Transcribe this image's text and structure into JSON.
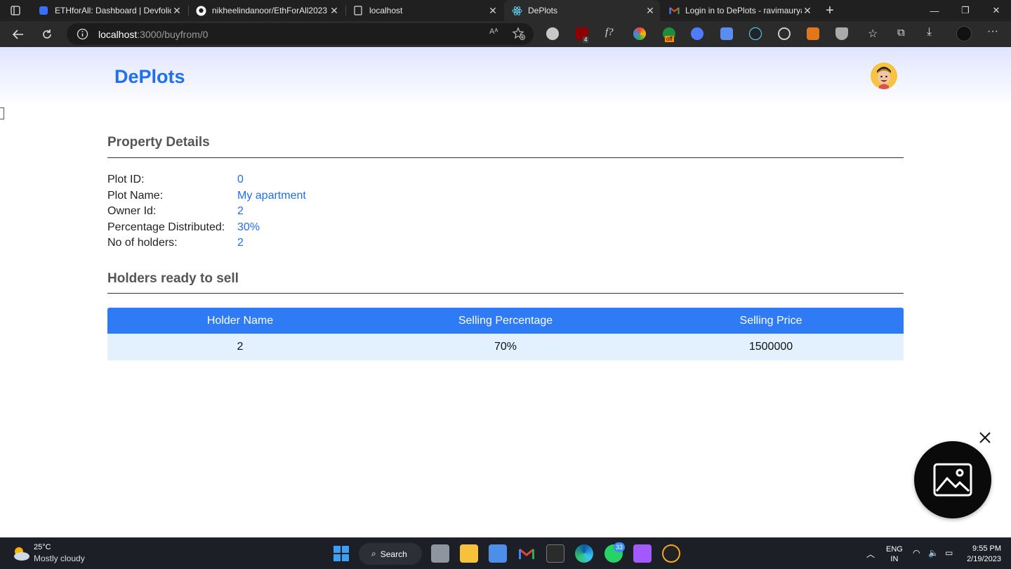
{
  "browser": {
    "tabs": [
      {
        "label": "ETHforAll: Dashboard | Devfolio",
        "icon": "devfolio-icon"
      },
      {
        "label": "nikheelindanoor/EthForAll2023",
        "icon": "github-icon"
      },
      {
        "label": "localhost",
        "icon": "page-icon"
      },
      {
        "label": "DePlots",
        "icon": "react-icon",
        "active": true
      },
      {
        "label": "Login in to DePlots - ravimaurya",
        "icon": "gmail-icon"
      }
    ],
    "url_host": "localhost",
    "url_rest": ":3000/buyfrom/0",
    "extension_badges": {
      "ublock": "4",
      "off": "off"
    }
  },
  "app": {
    "brand": "DePlots",
    "accent": "#1f6ff0"
  },
  "property": {
    "title": "Property Details",
    "fields": [
      {
        "label": "Plot ID:",
        "value": "0"
      },
      {
        "label": "Plot Name:",
        "value": "My apartment"
      },
      {
        "label": "Owner Id:",
        "value": "2"
      },
      {
        "label": "Percentage Distributed:",
        "value": "30%"
      },
      {
        "label": "No of holders:",
        "value": "2"
      }
    ]
  },
  "holders": {
    "title": "Holders ready to sell",
    "columns": [
      "Holder Name",
      "Selling Percentage",
      "Selling Price"
    ],
    "rows": [
      [
        "2",
        "70%",
        "1500000"
      ]
    ]
  },
  "taskbar": {
    "temperature": "25°C",
    "weather": "Mostly cloudy",
    "search_label": "Search",
    "whatsapp_badge": "33",
    "lang_line1": "ENG",
    "lang_line2": "IN",
    "time": "9:55 PM",
    "date": "2/19/2023"
  }
}
